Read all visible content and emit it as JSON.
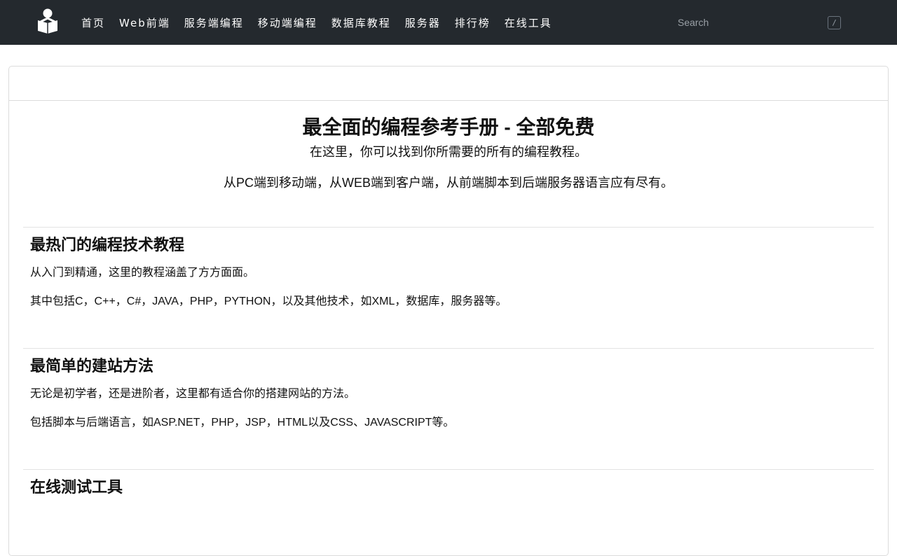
{
  "nav": {
    "logo_icon": "book-reader-icon",
    "links": [
      "首页",
      "Web前端",
      "服务端编程",
      "移动端编程",
      "数据库教程",
      "服务器",
      "排行榜",
      "在线工具"
    ],
    "search_placeholder": "Search",
    "search_shortcut": "/"
  },
  "hero": {
    "title": "最全面的编程参考手册 - 全部免费",
    "line1": "在这里，你可以找到你所需要的所有的编程教程。",
    "line2": "从PC端到移动端，从WEB端到客户端，从前端脚本到后端服务器语言应有尽有。"
  },
  "sections": [
    {
      "title": "最热门的编程技术教程",
      "p1": "从入门到精通，这里的教程涵盖了方方面面。",
      "p2": "其中包括C，C++，C#，JAVA，PHP，PYTHON，以及其他技术，如XML，数据库，服务器等。"
    },
    {
      "title": "最简单的建站方法",
      "p1": "无论是初学者，还是进阶者，这里都有适合你的搭建网站的方法。",
      "p2": "包括脚本与后端语言，如ASP.NET，PHP，JSP，HTML以及CSS、JAVASCRIPT等。"
    },
    {
      "title": "在线测试工具"
    }
  ],
  "colors": {
    "navbar_bg": "#24292e",
    "nav_text": "#ffffff"
  }
}
